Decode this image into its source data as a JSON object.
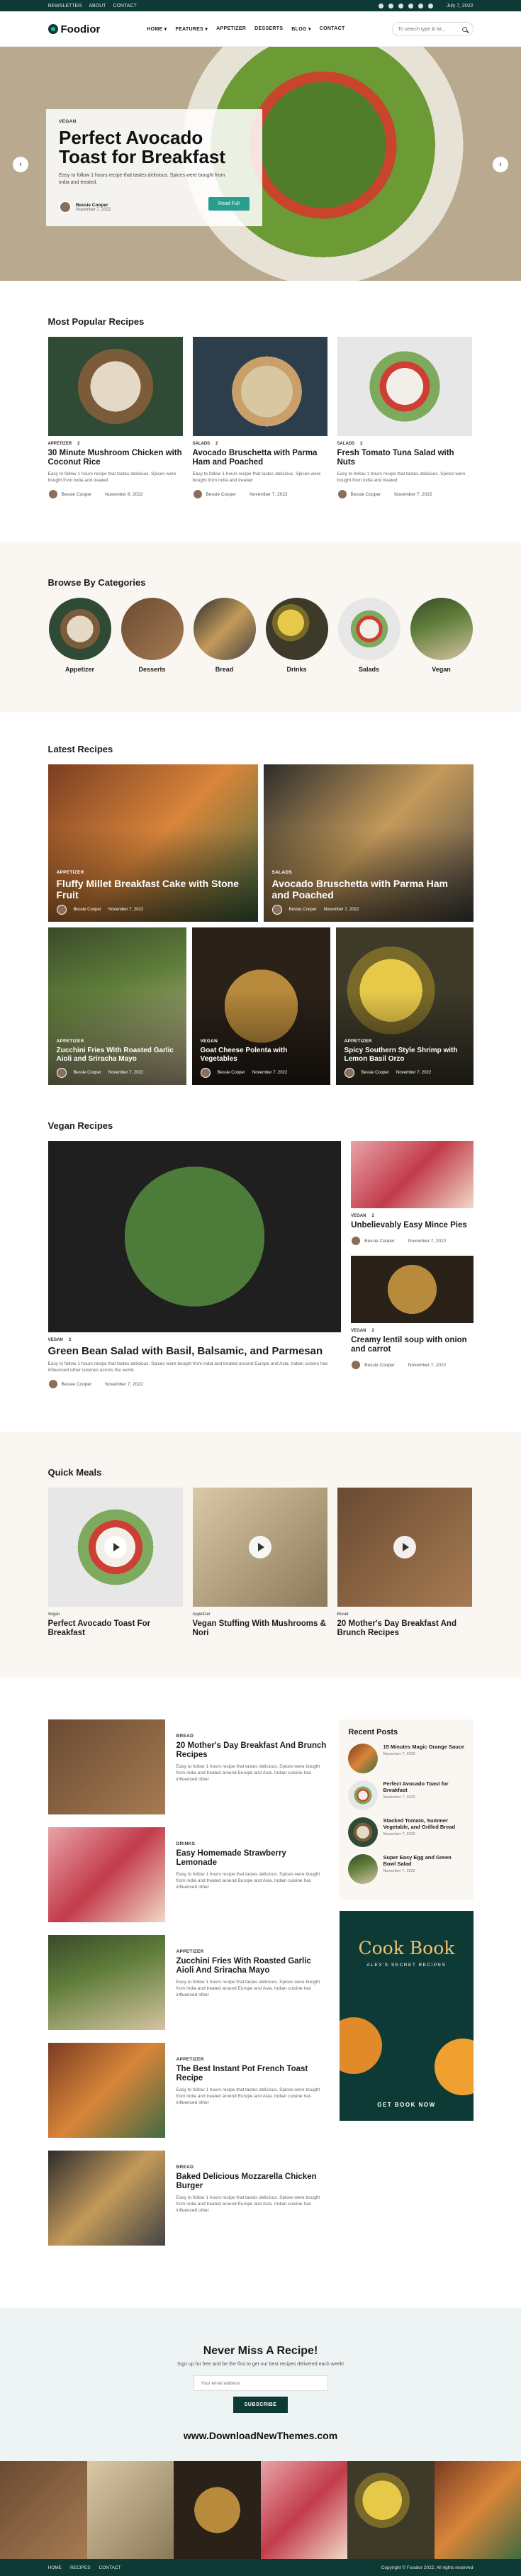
{
  "topbar": {
    "links": [
      "NEWSLETTER",
      "ABOUT",
      "CONTACT"
    ],
    "date": "July 7, 2022"
  },
  "header": {
    "logo": "Foodior",
    "nav": [
      "HOME ▾",
      "FEATURES ▾",
      "APPETIZER",
      "DESSERTS",
      "BLOG ▾",
      "CONTACT"
    ],
    "search_placeholder": "To search type & hit..."
  },
  "hero": {
    "tag": "VEGAN",
    "title": "Perfect Avocado Toast for Breakfast",
    "excerpt": "Easy to follow 1 hours recipe that tastes delicious. Spices were bought from india and treated.",
    "author": "Bessie Cooper",
    "date": "November 7, 2022",
    "button": "Read Full"
  },
  "popular": {
    "title": "Most Popular Recipes",
    "items": [
      {
        "tag": "APPETIZER",
        "count": "2",
        "title": "30 Minute Mushroom Chicken with Coconut Rice",
        "excerpt": "Easy to follow 1 hours recipe that tastes delicious. Spices were bought from india and treated",
        "author": "Bessie Cooper",
        "date": "November 8, 2022"
      },
      {
        "tag": "SALADS",
        "count": "2",
        "title": "Avocado Bruschetta with Parma Ham and Poached",
        "excerpt": "Easy to follow 1 hours recipe that tastes delicious. Spices were bought from india and treated",
        "author": "Bessie Cooper",
        "date": "November 7, 2022"
      },
      {
        "tag": "SALADS",
        "count": "2",
        "title": "Fresh Tomato Tuna Salad with Nuts",
        "excerpt": "Easy to follow 1 hours recipe that tastes delicious. Spices were bought from india and treated",
        "author": "Bessie Cooper",
        "date": "November 7, 2022"
      }
    ]
  },
  "categories": {
    "title": "Browse By Categories",
    "items": [
      "Appetizer",
      "Desserts",
      "Bread",
      "Drinks",
      "Salads",
      "Vegan"
    ]
  },
  "latest": {
    "title": "Latest Recipes",
    "items": [
      {
        "tag": "APPETIZER",
        "title": "Fluffy Millet Breakfast Cake with Stone Fruit",
        "author": "Bessie Cooper",
        "date": "November 7, 2022"
      },
      {
        "tag": "SALADS",
        "title": "Avocado Bruschetta with Parma Ham and Poached",
        "author": "Bessie Cooper",
        "date": "November 7, 2022"
      },
      {
        "tag": "APPETIZER",
        "title": "Zucchini Fries With Roasted Garlic Aioli and Sriracha Mayo",
        "author": "Bessie Cooper",
        "date": "November 7, 2022"
      },
      {
        "tag": "VEGAN",
        "title": "Goat Cheese Polenta with Vegetables",
        "author": "Bessie Cooper",
        "date": "November 7, 2022"
      },
      {
        "tag": "APPETIZER",
        "title": "Spicy Southern Style Shrimp with Lemon Basil Orzo",
        "author": "Bessie Cooper",
        "date": "November 7, 2022"
      }
    ]
  },
  "vegan": {
    "title": "Vegan Recipes",
    "main": {
      "tag": "VEGAN",
      "count": "2",
      "title": "Green Bean Salad with Basil, Balsamic, and Parmesan",
      "excerpt": "Easy to follow 1 hours recipe that tastes delicious. Spices were bought from india and treated around Europe and Asia. Indian cuisine has influenced other cuisines across the world.",
      "author": "Bessie Cooper",
      "date": "November 7, 2022"
    },
    "side": [
      {
        "tag": "VEGAN",
        "count": "2",
        "title": "Unbelievably Easy Mince Pies",
        "author": "Bessie Cooper",
        "date": "November 7, 2022"
      },
      {
        "tag": "VEGAN",
        "count": "2",
        "title": "Creamy lentil soup with onion and carrot",
        "author": "Bessie Cooper",
        "date": "November 7, 2022"
      }
    ]
  },
  "quick": {
    "title": "Quick Meals",
    "items": [
      {
        "tag": "Vegan",
        "title": "Perfect Avocado Toast For Breakfast"
      },
      {
        "tag": "Appetizer",
        "title": "Vegan Stuffing With Mushrooms & Nori"
      },
      {
        "tag": "Bread",
        "title": "20 Mother's Day Breakfast And Brunch Recipes"
      }
    ]
  },
  "list": [
    {
      "tag": "BREAD",
      "title": "20 Mother's Day Breakfast And Brunch Recipes",
      "excerpt": "Easy to follow 1 hours recipe that tastes delicious. Spices were bought from india and treated around Europe and Asia. Indian cuisine has influenced other"
    },
    {
      "tag": "DRINKS",
      "title": "Easy Homemade Strawberry Lemonade",
      "excerpt": "Easy to follow 1 hours recipe that tastes delicious. Spices were bought from india and treated around Europe and Asia. Indian cuisine has influenced other"
    },
    {
      "tag": "APPETIZER",
      "title": "Zucchini Fries With Roasted Garlic Aioli And Sriracha Mayo",
      "excerpt": "Easy to follow 1 hours recipe that tastes delicious. Spices were bought from india and treated around Europe and Asia. Indian cuisine has influenced other"
    },
    {
      "tag": "APPETIZER",
      "title": "The Best Instant Pot French Toast Recipe",
      "excerpt": "Easy to follow 1 hours recipe that tastes delicious. Spices were bought from india and treated around Europe and Asia. Indian cuisine has influenced other"
    },
    {
      "tag": "BREAD",
      "title": "Baked Delicious Mozzarella Chicken Burger",
      "excerpt": "Easy to follow 1 hours recipe that tastes delicious. Spices were bought from india and treated around Europe and Asia. Indian cuisine has influenced other"
    }
  ],
  "recent": {
    "title": "Recent Posts",
    "items": [
      {
        "title": "15 Minutes Magic Orange Sauce",
        "date": "November 7, 2022"
      },
      {
        "title": "Perfect Avocado Toast for Breakfast",
        "date": "November 7, 2022"
      },
      {
        "title": "Stacked Tomato, Summer Vegetable, and Grilled Bread",
        "date": "November 7, 2022"
      },
      {
        "title": "Super Easy Egg and Green Bowl Salad",
        "date": "November 7, 2022"
      }
    ]
  },
  "ad": {
    "title": "Cook Book",
    "subtitle": "ALEX'S SECRET RECIPES",
    "button": "GET BOOK NOW"
  },
  "newsletter": {
    "title": "Never Miss A Recipe!",
    "text": "Sign up for free and be the first to get our best recipes delivered each week!",
    "placeholder": "Your email address",
    "button": "SUBSCRIBE"
  },
  "watermark": "www.DownloadNewThemes.com",
  "footer": {
    "links": [
      "HOME",
      "RECIPES",
      "CONTACT"
    ],
    "copyright": "Copyright © Foodior 2022. All rights reserved"
  }
}
